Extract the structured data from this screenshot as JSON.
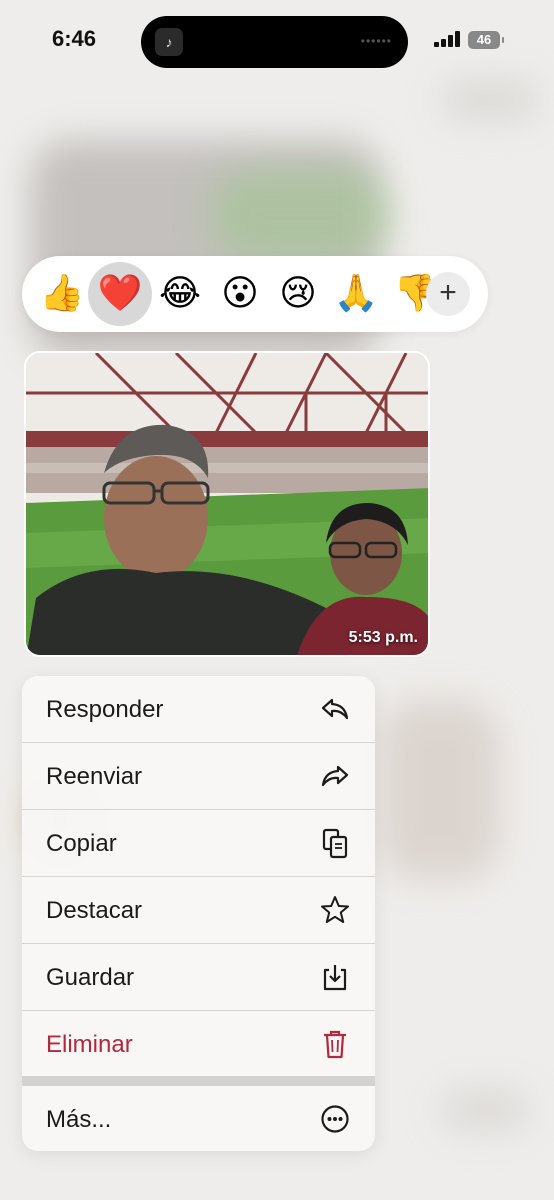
{
  "status_bar": {
    "time": "6:46",
    "battery": "46",
    "island_app_glyph": "♪",
    "island_indicator": "••••••"
  },
  "reactions": {
    "items": [
      {
        "emoji": "👍",
        "name": "thumbs-up"
      },
      {
        "emoji": "❤️",
        "name": "heart",
        "selected": true
      },
      {
        "emoji": "😂",
        "name": "laughing"
      },
      {
        "emoji": "😮",
        "name": "surprised"
      },
      {
        "emoji": "😢",
        "name": "crying"
      },
      {
        "emoji": "🙏",
        "name": "pray"
      },
      {
        "emoji": "👎",
        "name": "thumbs-down"
      }
    ],
    "more_label": "+"
  },
  "message": {
    "timestamp": "5:53 p.m."
  },
  "menu": {
    "items": [
      {
        "label": "Responder",
        "icon": "reply-icon"
      },
      {
        "label": "Reenviar",
        "icon": "forward-icon"
      },
      {
        "label": "Copiar",
        "icon": "copy-icon"
      },
      {
        "label": "Destacar",
        "icon": "star-icon"
      },
      {
        "label": "Guardar",
        "icon": "save-icon"
      },
      {
        "label": "Eliminar",
        "icon": "trash-icon",
        "color": "#b3283c"
      }
    ],
    "more": {
      "label": "Más...",
      "icon": "ellipsis-circle-icon"
    }
  },
  "colors": {
    "destructive": "#b3283c",
    "background": "#efedeb"
  }
}
